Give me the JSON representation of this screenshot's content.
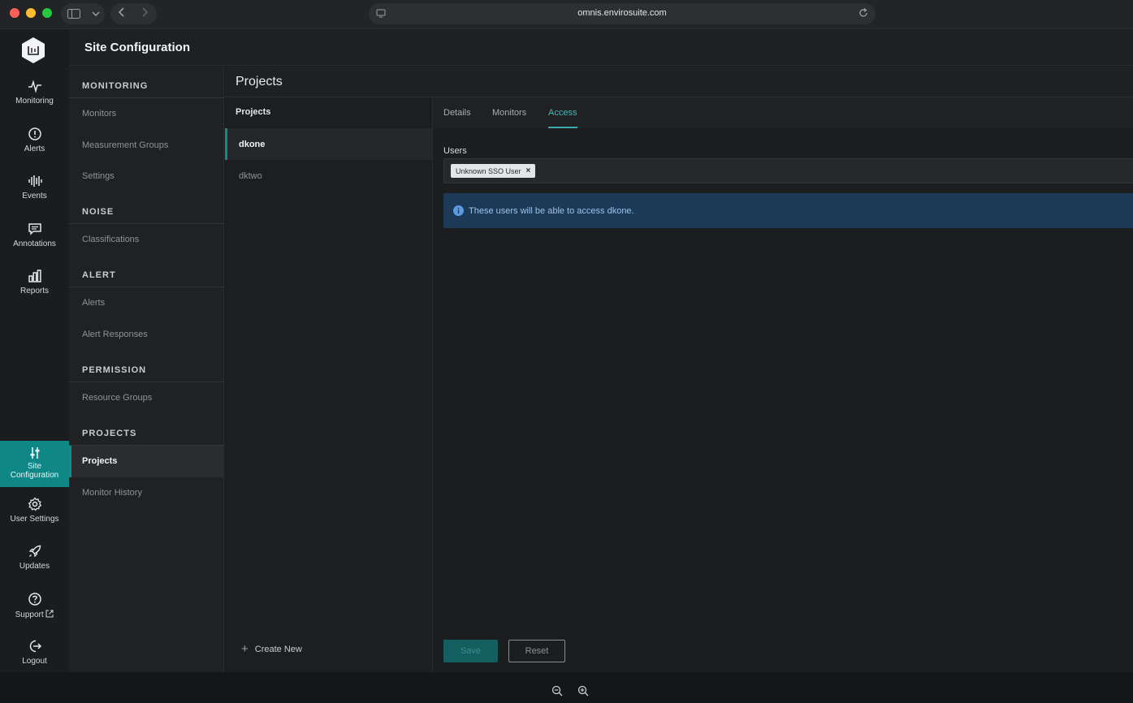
{
  "browser": {
    "url": "omnis.envirosuite.com"
  },
  "rail": {
    "items": [
      {
        "label": "Monitoring",
        "icon": "pulse-icon"
      },
      {
        "label": "Alerts",
        "icon": "alert-circle-icon"
      },
      {
        "label": "Events",
        "icon": "waveform-icon"
      },
      {
        "label": "Annotations",
        "icon": "comment-icon"
      },
      {
        "label": "Reports",
        "icon": "bar-chart-icon"
      },
      {
        "label_line1": "Site",
        "label_line2": "Configuration",
        "icon": "sliders-icon",
        "active": true
      },
      {
        "label": "User Settings",
        "icon": "gear-icon"
      },
      {
        "label": "Updates",
        "icon": "rocket-icon"
      },
      {
        "label": "Support",
        "icon": "help-circle-icon"
      },
      {
        "label": "Logout",
        "icon": "logout-icon"
      }
    ]
  },
  "header": {
    "title": "Site Configuration"
  },
  "confnav": {
    "monitoring": {
      "heading": "MONITORING",
      "items": [
        "Monitors",
        "Measurement Groups",
        "Settings"
      ]
    },
    "noise": {
      "heading": "NOISE",
      "items": [
        "Classifications"
      ]
    },
    "alert": {
      "heading": "ALERT",
      "items": [
        "Alerts",
        "Alert Responses"
      ]
    },
    "permission": {
      "heading": "PERMISSION",
      "items": [
        "Resource Groups"
      ]
    },
    "projects": {
      "heading": "PROJECTS",
      "items": [
        "Projects",
        "Monitor History"
      ],
      "active": "Projects"
    }
  },
  "projects_panel": {
    "title": "Projects",
    "list_heading": "Projects",
    "items": [
      "dkone",
      "dktwo"
    ],
    "active": "dkone",
    "create_new": "Create New"
  },
  "detail": {
    "tabs": [
      "Details",
      "Monitors",
      "Access"
    ],
    "active_tab": "Access",
    "users_label": "Users",
    "users": [
      "Unknown SSO User"
    ],
    "info_text": "These users will be able to access dkone.",
    "save_label": "Save",
    "reset_label": "Reset"
  },
  "colors": {
    "accent": "#0f8787",
    "info_bg": "#1c3a57",
    "info_text": "#9cc4eb"
  }
}
